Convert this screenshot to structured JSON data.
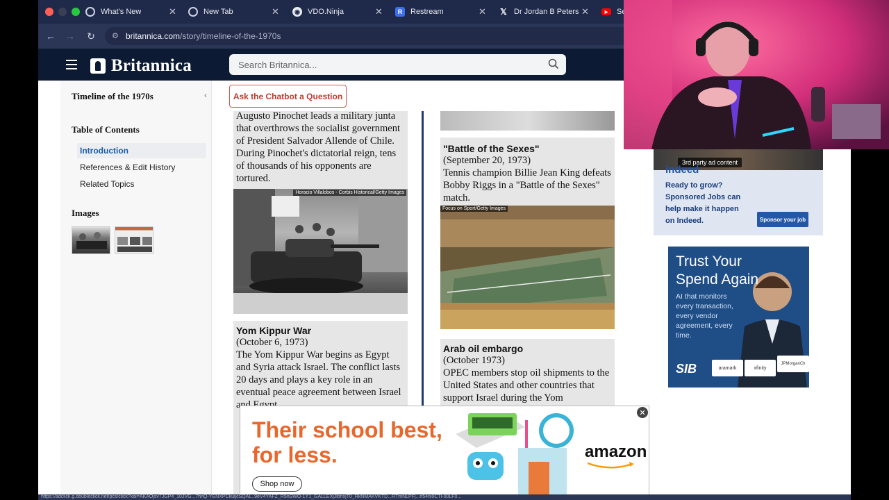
{
  "browser": {
    "tabs": [
      {
        "label": "What's New",
        "icon": "chrome-icon"
      },
      {
        "label": "New Tab",
        "icon": "chrome-icon"
      },
      {
        "label": "VDO.Ninja",
        "icon": "vdo-ninja-icon"
      },
      {
        "label": "Restream",
        "icon": "restream-icon"
      },
      {
        "label": "Dr Jordan B Peterso",
        "icon": "x-icon"
      },
      {
        "label": "Se",
        "icon": "youtube-icon"
      }
    ],
    "url_host": "britannica.com",
    "url_path": "/story/timeline-of-the-1970s",
    "status_text": "https://adclick.g.doubleclick.net/pcs/click?xai=AKAOjsv7JGP4_10JVG...7hnQ-YENXPCkuijcSQAL..9eV4YAFZ_R5nSWO-1Y1_GALLEXjJltmxjT0_RkNMAKVKTD...RTmNLPFj...rl54nl0CTl-00LF0..."
  },
  "site": {
    "logo_text": "Britannica",
    "search_placeholder": "Search Britannica..."
  },
  "sidebar": {
    "title": "Timeline of the 1970s",
    "toc_heading": "Table of Contents",
    "toc_items": [
      "Introduction",
      "References & Edit History",
      "Related Topics"
    ],
    "images_heading": "Images"
  },
  "main": {
    "chatbot_label": "Ask the Chatbot a Question",
    "pinochet": {
      "body": "Augusto Pinochet leads a military junta that overthrows the socialist government of President Salvador Allende of Chile. During Pinochet's dictatorial reign, tens of thousands of his opponents are tortured.",
      "credit": "Horacio Villalobos - Corbis Historical/Getty Images"
    },
    "yomkippur": {
      "title": "Yom Kippur War",
      "date": "(October 6, 1973)",
      "body": "The Yom Kippur War begins as Egypt and Syria attack Israel. The conflict lasts 20 days and plays a key role in an eventual peace agreement between Israel and Egypt."
    },
    "battle": {
      "title": "\"Battle of the Sexes\"",
      "date": "(September 20, 1973)",
      "body": "Tennis champion Billie Jean King defeats Bobby Riggs in a \"Battle of the Sexes\" match.",
      "credit": "Focus on Sport/Getty Images"
    },
    "oil": {
      "title": "Arab oil embargo",
      "date": "(October 1973)",
      "body": "OPEC members stop oil shipments to the United States and other countries that support Israel during the Yom"
    }
  },
  "ads": {
    "indeed": {
      "label": "3rd party ad content",
      "brand": "indeed",
      "text": "Ready to grow? Sponsored Jobs can help make it happen on Indeed.",
      "cta": "Sponsor your job"
    },
    "sib": {
      "headline": "Trust Your Spend Again",
      "body": "AI that monitors every transaction, every vendor agreement, every time.",
      "brand": "SIB",
      "partners": [
        "aramark",
        "xfinity",
        "JPMorganCh"
      ]
    },
    "amazon": {
      "headline_1": "Their school best,",
      "headline_2": "for less.",
      "cta": "Shop now",
      "brand": "amazon",
      "close": "✕"
    }
  },
  "colors": {
    "tabbar": "#1f2a4a",
    "header": "#0c1a33",
    "accent_link": "#1a5ea8",
    "chatbot_red": "#c0392b",
    "amazon_orange": "#e8672c"
  }
}
